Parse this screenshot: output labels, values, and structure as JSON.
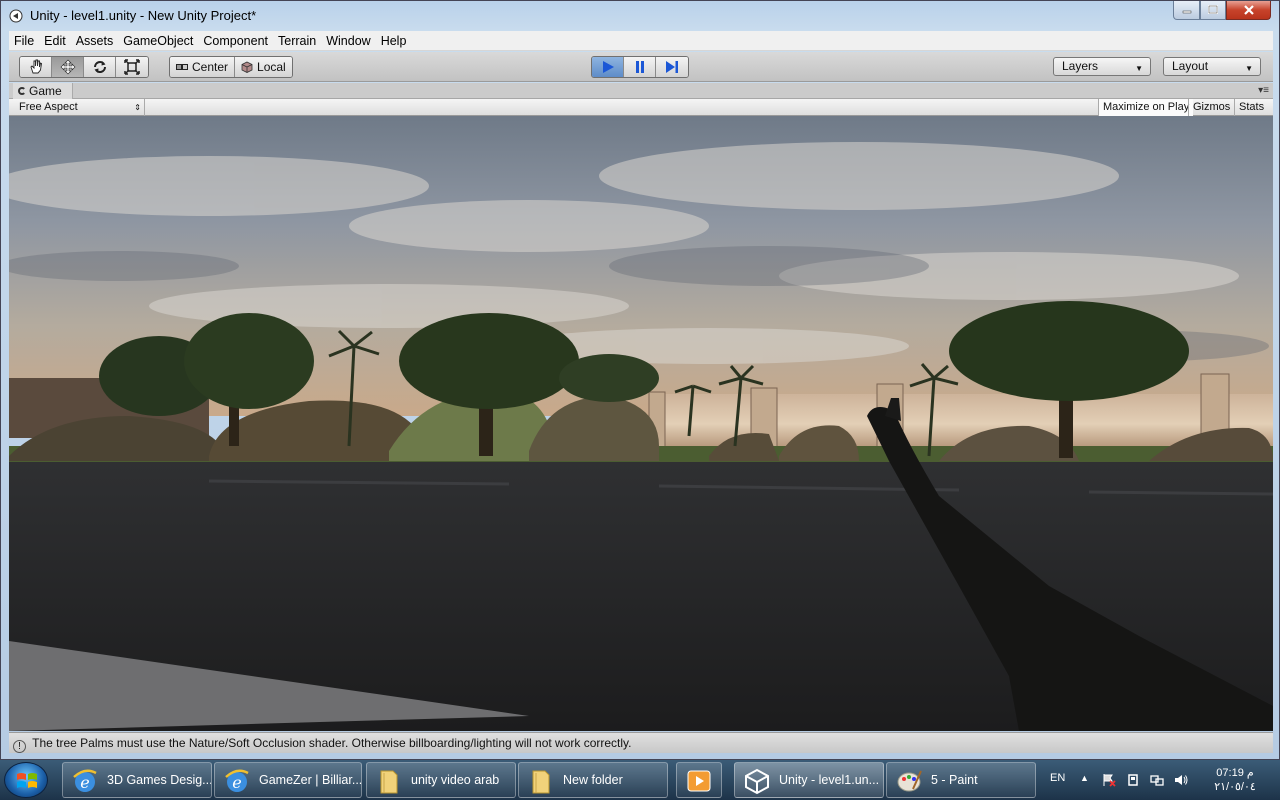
{
  "window": {
    "title": "Unity - level1.unity - New Unity Project*"
  },
  "menubar": {
    "items": [
      "File",
      "Edit",
      "Assets",
      "GameObject",
      "Component",
      "Terrain",
      "Window",
      "Help"
    ]
  },
  "toolbar": {
    "tools": [
      "hand-icon",
      "move-icon",
      "rotate-icon",
      "scale-icon"
    ],
    "active_tool": "move-icon",
    "pivot_label": "Center",
    "space_label": "Local",
    "play_state": "playing",
    "layers_label": "Layers",
    "layout_label": "Layout"
  },
  "game_view": {
    "tab_label": "Game",
    "aspect_label": "Free Aspect",
    "maximize_label": "Maximize on Play",
    "gizmos_label": "Gizmos",
    "stats_label": "Stats"
  },
  "status": {
    "message": "The tree Palms must use the Nature/Soft Occlusion shader. Otherwise billboarding/lighting will not work correctly."
  },
  "taskbar": {
    "tasks": [
      {
        "label": "3D Games Desig...",
        "icon": "ie-icon"
      },
      {
        "label": "GameZer | Billiar...",
        "icon": "ie-icon"
      },
      {
        "label": "unity video arab",
        "icon": "folder-icon"
      },
      {
        "label": "New folder",
        "icon": "folder-icon"
      },
      {
        "label": "",
        "icon": "media-player-icon"
      },
      {
        "label": "Unity - level1.un...",
        "icon": "unity-icon"
      },
      {
        "label": "5 - Paint",
        "icon": "paint-icon"
      }
    ],
    "language": "EN",
    "time": "07:19 م",
    "date": "٢١/٠٥/٠٤"
  },
  "colors": {
    "play_active": "#5e8cc8",
    "title_bar": "#b9d1ea",
    "taskbar": "#1d3349"
  }
}
